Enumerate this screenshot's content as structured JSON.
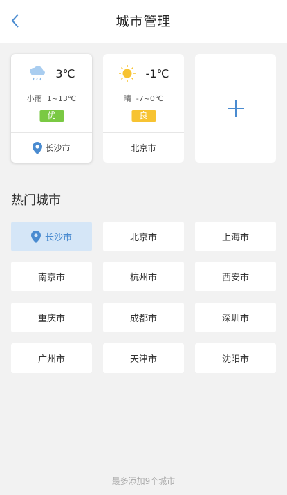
{
  "header": {
    "title": "城市管理",
    "back_icon": "chevron-left-icon",
    "accent": "#4a8bd0"
  },
  "my_cities": [
    {
      "temp": "3℃",
      "desc": "小雨  1~13℃",
      "aqi": "优",
      "aqi_color": "#7ac943",
      "city": "长沙市",
      "icon": "light-rain-icon",
      "current_location": true
    },
    {
      "temp": "-1℃",
      "desc": "晴  -7~0℃",
      "aqi": "良",
      "aqi_color": "#f7c332",
      "city": "北京市",
      "icon": "sunny-icon",
      "current_location": false
    }
  ],
  "add_card": {
    "icon": "plus-icon"
  },
  "hot_cities": {
    "title": "热门城市",
    "items": [
      "长沙市",
      "北京市",
      "上海市",
      "南京市",
      "杭州市",
      "西安市",
      "重庆市",
      "成都市",
      "深圳市",
      "广州市",
      "天津市",
      "沈阳市"
    ]
  },
  "footer": {
    "note": "最多添加9个城市"
  }
}
